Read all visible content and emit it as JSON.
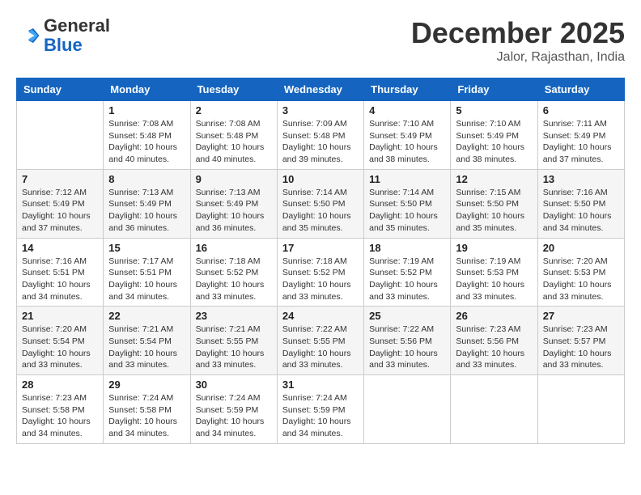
{
  "header": {
    "logo_general": "General",
    "logo_blue": "Blue",
    "month_year": "December 2025",
    "location": "Jalor, Rajasthan, India"
  },
  "weekdays": [
    "Sunday",
    "Monday",
    "Tuesday",
    "Wednesday",
    "Thursday",
    "Friday",
    "Saturday"
  ],
  "weeks": [
    [
      {
        "day": "",
        "sunrise": "",
        "sunset": "",
        "daylight": ""
      },
      {
        "day": "1",
        "sunrise": "7:08 AM",
        "sunset": "5:48 PM",
        "daylight": "10 hours and 40 minutes."
      },
      {
        "day": "2",
        "sunrise": "7:08 AM",
        "sunset": "5:48 PM",
        "daylight": "10 hours and 40 minutes."
      },
      {
        "day": "3",
        "sunrise": "7:09 AM",
        "sunset": "5:48 PM",
        "daylight": "10 hours and 39 minutes."
      },
      {
        "day": "4",
        "sunrise": "7:10 AM",
        "sunset": "5:49 PM",
        "daylight": "10 hours and 38 minutes."
      },
      {
        "day": "5",
        "sunrise": "7:10 AM",
        "sunset": "5:49 PM",
        "daylight": "10 hours and 38 minutes."
      },
      {
        "day": "6",
        "sunrise": "7:11 AM",
        "sunset": "5:49 PM",
        "daylight": "10 hours and 37 minutes."
      }
    ],
    [
      {
        "day": "7",
        "sunrise": "7:12 AM",
        "sunset": "5:49 PM",
        "daylight": "10 hours and 37 minutes."
      },
      {
        "day": "8",
        "sunrise": "7:13 AM",
        "sunset": "5:49 PM",
        "daylight": "10 hours and 36 minutes."
      },
      {
        "day": "9",
        "sunrise": "7:13 AM",
        "sunset": "5:49 PM",
        "daylight": "10 hours and 36 minutes."
      },
      {
        "day": "10",
        "sunrise": "7:14 AM",
        "sunset": "5:50 PM",
        "daylight": "10 hours and 35 minutes."
      },
      {
        "day": "11",
        "sunrise": "7:14 AM",
        "sunset": "5:50 PM",
        "daylight": "10 hours and 35 minutes."
      },
      {
        "day": "12",
        "sunrise": "7:15 AM",
        "sunset": "5:50 PM",
        "daylight": "10 hours and 35 minutes."
      },
      {
        "day": "13",
        "sunrise": "7:16 AM",
        "sunset": "5:50 PM",
        "daylight": "10 hours and 34 minutes."
      }
    ],
    [
      {
        "day": "14",
        "sunrise": "7:16 AM",
        "sunset": "5:51 PM",
        "daylight": "10 hours and 34 minutes."
      },
      {
        "day": "15",
        "sunrise": "7:17 AM",
        "sunset": "5:51 PM",
        "daylight": "10 hours and 34 minutes."
      },
      {
        "day": "16",
        "sunrise": "7:18 AM",
        "sunset": "5:52 PM",
        "daylight": "10 hours and 33 minutes."
      },
      {
        "day": "17",
        "sunrise": "7:18 AM",
        "sunset": "5:52 PM",
        "daylight": "10 hours and 33 minutes."
      },
      {
        "day": "18",
        "sunrise": "7:19 AM",
        "sunset": "5:52 PM",
        "daylight": "10 hours and 33 minutes."
      },
      {
        "day": "19",
        "sunrise": "7:19 AM",
        "sunset": "5:53 PM",
        "daylight": "10 hours and 33 minutes."
      },
      {
        "day": "20",
        "sunrise": "7:20 AM",
        "sunset": "5:53 PM",
        "daylight": "10 hours and 33 minutes."
      }
    ],
    [
      {
        "day": "21",
        "sunrise": "7:20 AM",
        "sunset": "5:54 PM",
        "daylight": "10 hours and 33 minutes."
      },
      {
        "day": "22",
        "sunrise": "7:21 AM",
        "sunset": "5:54 PM",
        "daylight": "10 hours and 33 minutes."
      },
      {
        "day": "23",
        "sunrise": "7:21 AM",
        "sunset": "5:55 PM",
        "daylight": "10 hours and 33 minutes."
      },
      {
        "day": "24",
        "sunrise": "7:22 AM",
        "sunset": "5:55 PM",
        "daylight": "10 hours and 33 minutes."
      },
      {
        "day": "25",
        "sunrise": "7:22 AM",
        "sunset": "5:56 PM",
        "daylight": "10 hours and 33 minutes."
      },
      {
        "day": "26",
        "sunrise": "7:23 AM",
        "sunset": "5:56 PM",
        "daylight": "10 hours and 33 minutes."
      },
      {
        "day": "27",
        "sunrise": "7:23 AM",
        "sunset": "5:57 PM",
        "daylight": "10 hours and 33 minutes."
      }
    ],
    [
      {
        "day": "28",
        "sunrise": "7:23 AM",
        "sunset": "5:58 PM",
        "daylight": "10 hours and 34 minutes."
      },
      {
        "day": "29",
        "sunrise": "7:24 AM",
        "sunset": "5:58 PM",
        "daylight": "10 hours and 34 minutes."
      },
      {
        "day": "30",
        "sunrise": "7:24 AM",
        "sunset": "5:59 PM",
        "daylight": "10 hours and 34 minutes."
      },
      {
        "day": "31",
        "sunrise": "7:24 AM",
        "sunset": "5:59 PM",
        "daylight": "10 hours and 34 minutes."
      },
      {
        "day": "",
        "sunrise": "",
        "sunset": "",
        "daylight": ""
      },
      {
        "day": "",
        "sunrise": "",
        "sunset": "",
        "daylight": ""
      },
      {
        "day": "",
        "sunrise": "",
        "sunset": "",
        "daylight": ""
      }
    ]
  ]
}
